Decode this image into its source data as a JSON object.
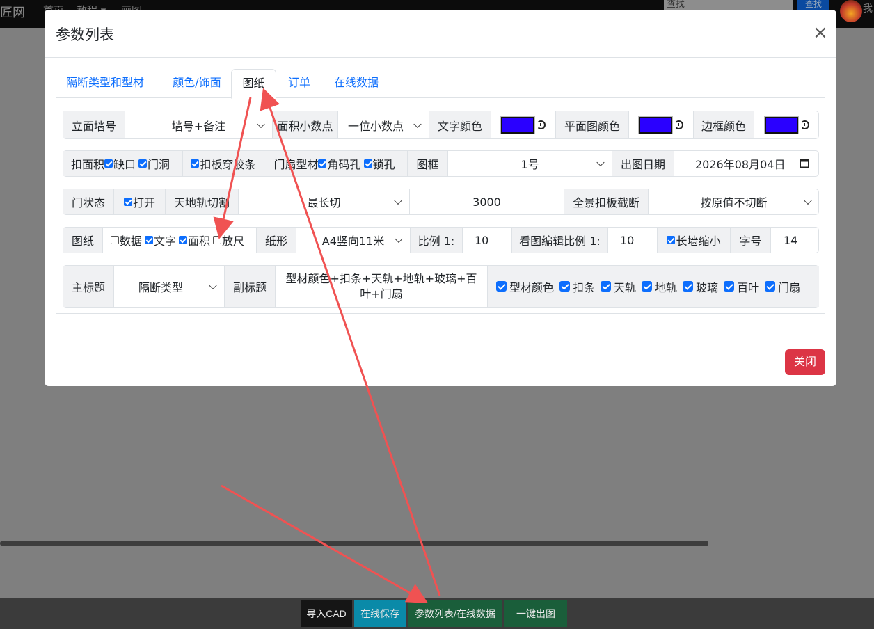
{
  "nav": {
    "brand": "匠网",
    "links": [
      "首页",
      "教程 ▾",
      "画图"
    ],
    "search_placeholder": "查找",
    "search_btn": "查找",
    "user": "我"
  },
  "bottom_buttons": [
    {
      "label": "导入CAD",
      "color": "#151515"
    },
    {
      "label": "在线保存",
      "color": "#0a8aa8"
    },
    {
      "label": "参数列表/在线数据",
      "color": "#1a5e3a"
    },
    {
      "label": "一键出图",
      "color": "#1a5e3a"
    }
  ],
  "modal": {
    "title": "参数列表",
    "close_label": "关闭",
    "tabs": [
      "隔断类型和型材",
      "颜色/饰面",
      "图纸",
      "订单",
      "在线数据"
    ],
    "active_tab": "图纸"
  },
  "row1": {
    "elevation_label": "立面墙号",
    "elevation_value": "墙号+备注",
    "area_decimal_label": "面积小数点",
    "area_decimal_value": "一位小数点",
    "text_color_label": "文字颜色",
    "text_color": "#2a00ff",
    "plan_color_label": "平面图颜色",
    "plan_color": "#2a00ff",
    "border_color_label": "边框颜色",
    "border_color": "#2a00ff"
  },
  "row2": {
    "deduct_label": "扣面积",
    "notch": "缺口",
    "door_hole": "门洞",
    "strip": "扣板穿胶条",
    "door_profile_label": "门扇型材",
    "corner_hole": "角码孔",
    "lock_hole": "锁孔",
    "frame_label": "图框",
    "frame_value": "1号",
    "date_label": "出图日期",
    "date_value": "2026年08月04日"
  },
  "row3": {
    "door_state_label": "门状态",
    "open": "打开",
    "rail_cut_label": "天地轨切割",
    "rail_cut_value": "最长切",
    "length_value": "3000",
    "panorama_label": "全景扣板截断",
    "panorama_value": "按原值不切断"
  },
  "row4": {
    "drawing_label": "图纸",
    "data": "数据",
    "text": "文字",
    "area": "面积",
    "scale_dim": "放尺",
    "paper_label": "纸形",
    "paper_value": "A4竖向11米",
    "ratio_label": "比例 1:",
    "ratio_value": "10",
    "edit_ratio_label": "看图编辑比例 1:",
    "edit_ratio_value": "10",
    "long_wall": "长墙缩小",
    "font_size_label": "字号",
    "font_size_value": "14"
  },
  "row5": {
    "main_title_label": "主标题",
    "main_title_value": "隔断类型",
    "subtitle_label": "副标题",
    "subtitle_value": "型材颜色+扣条+天轨+地轨+玻璃+百叶+门扇",
    "options": [
      "型材颜色",
      "扣条",
      "天轨",
      "地轨",
      "玻璃",
      "百叶",
      "门扇"
    ]
  },
  "annotation_color": "#f05252"
}
